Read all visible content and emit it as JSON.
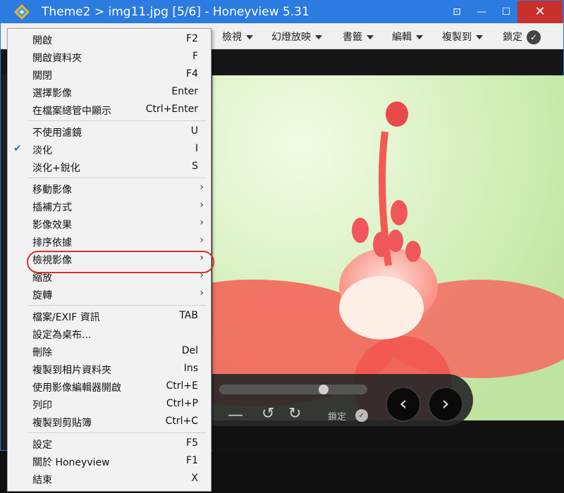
{
  "window": {
    "title": "Theme2 > img11.jpg [5/6] - Honeyview 5.31",
    "close_glyph": "✕",
    "min_glyph": "—",
    "max_glyph": "☐",
    "pin_glyph": "⊡"
  },
  "menubar": {
    "items": [
      {
        "label": "檢視"
      },
      {
        "label": "幻燈放映"
      },
      {
        "label": "書籤"
      },
      {
        "label": "編輯"
      },
      {
        "label": "複製到"
      }
    ],
    "lock_label": "鎖定"
  },
  "controls": {
    "lock_label": "鎖定",
    "seek_fraction": 0.72
  },
  "context_menu": {
    "groups": [
      [
        {
          "label": "開啟",
          "shortcut": "F2"
        },
        {
          "label": "開啟資料夾",
          "shortcut": "F"
        },
        {
          "label": "關閉",
          "shortcut": "F4"
        },
        {
          "label": "選擇影像",
          "shortcut": "Enter"
        },
        {
          "label": "在檔案總管中顯示",
          "shortcut": "Ctrl+Enter"
        }
      ],
      [
        {
          "label": "不使用濾鏡",
          "shortcut": "U"
        },
        {
          "label": "淡化",
          "shortcut": "I",
          "checked": true
        },
        {
          "label": "淡化+銳化",
          "shortcut": "S"
        }
      ],
      [
        {
          "label": "移動影像",
          "submenu": true
        },
        {
          "label": "插補方式",
          "submenu": true
        },
        {
          "label": "影像效果",
          "submenu": true
        },
        {
          "label": "排序依據",
          "submenu": true
        },
        {
          "label": "檢視影像",
          "submenu": true,
          "highlighted": true
        },
        {
          "label": "縮放",
          "submenu": true
        },
        {
          "label": "旋轉",
          "submenu": true
        }
      ],
      [
        {
          "label": "檔案/EXIF 資訊",
          "shortcut": "TAB"
        },
        {
          "label": "設定為桌布...",
          "shortcut": ""
        },
        {
          "label": "刪除",
          "shortcut": "Del"
        },
        {
          "label": "複製到相片資料夾",
          "shortcut": "Ins"
        },
        {
          "label": "使用影像編輯器開啟",
          "shortcut": "Ctrl+E"
        },
        {
          "label": "列印",
          "shortcut": "Ctrl+P"
        },
        {
          "label": "複製到剪貼簿",
          "shortcut": "Ctrl+C"
        }
      ],
      [
        {
          "label": "設定",
          "shortcut": "F5"
        },
        {
          "label": "關於 Honeyview",
          "shortcut": "F1"
        },
        {
          "label": "結束",
          "shortcut": "X"
        }
      ]
    ]
  },
  "colors": {
    "titlebar": "#2b7be0",
    "highlight_ring": "#d9312b",
    "check": "#2a6fd0"
  }
}
